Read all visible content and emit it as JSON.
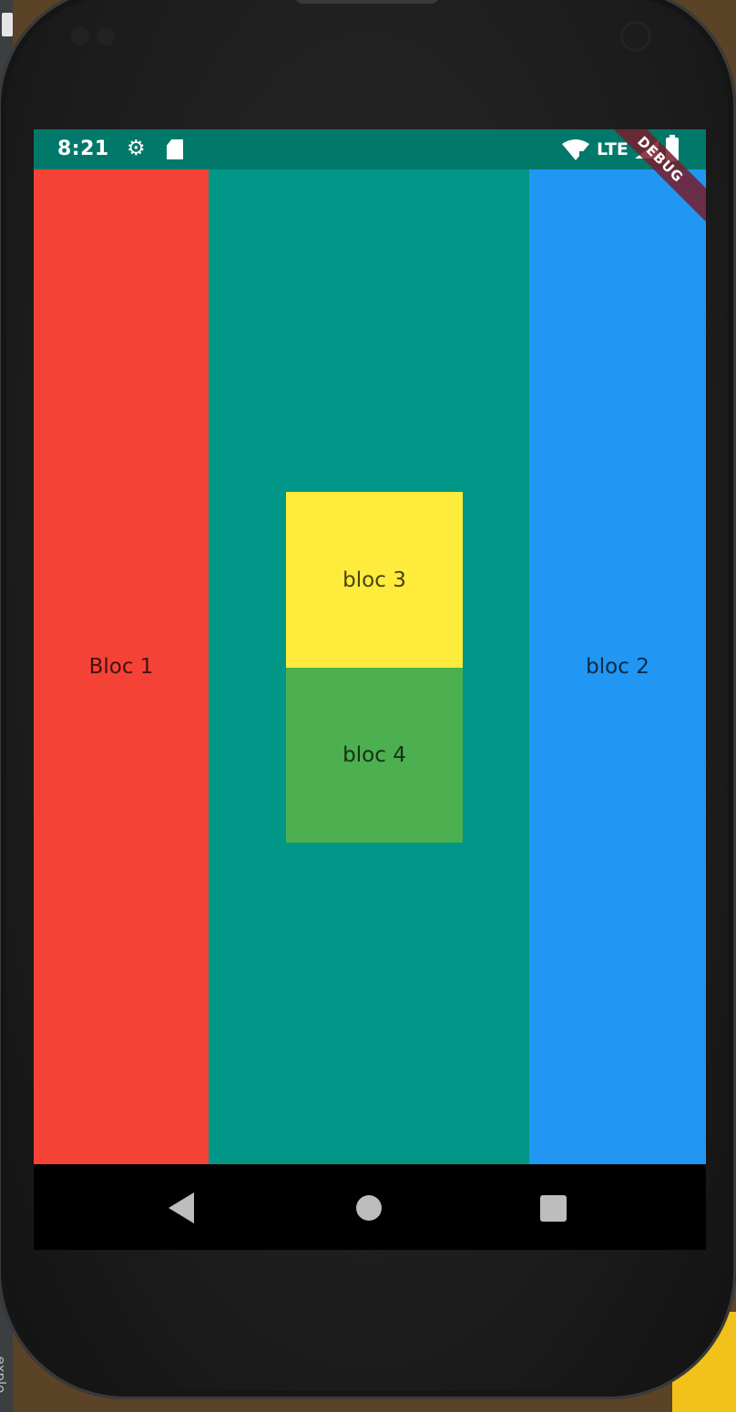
{
  "ide": {
    "side_label": "explo"
  },
  "status_bar": {
    "time": "8:21",
    "network": "LTE",
    "ribbon": "DEBUG",
    "icons": [
      "gear-icon",
      "sd-card-icon",
      "wifi-icon",
      "cell-signal-icon",
      "battery-icon"
    ],
    "color": "#00796b"
  },
  "blocks": {
    "bloc1": {
      "label": "Bloc 1",
      "color": "#f44336"
    },
    "center": {
      "color": "#009688"
    },
    "bloc2": {
      "label": "bloc 2",
      "color": "#2196f3"
    },
    "bloc3": {
      "label": "bloc 3",
      "color": "#ffeb3b"
    },
    "bloc4": {
      "label": "bloc 4",
      "color": "#4caf50"
    }
  },
  "nav_bar": {
    "icons": [
      "back-icon",
      "home-icon",
      "recents-icon"
    ]
  }
}
